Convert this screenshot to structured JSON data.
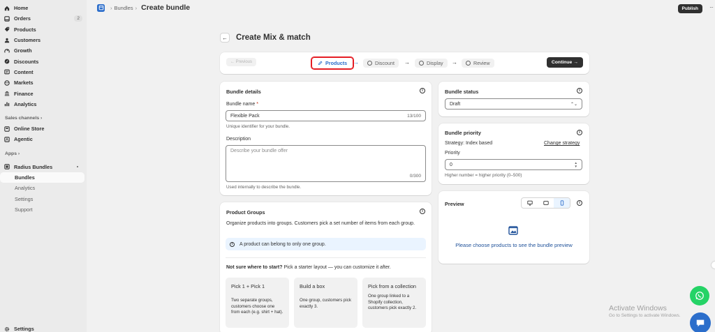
{
  "sidebar": {
    "items": [
      {
        "label": "Home",
        "icon": "home-icon"
      },
      {
        "label": "Orders",
        "icon": "orders-icon",
        "badge": "2"
      },
      {
        "label": "Products",
        "icon": "tag-icon"
      },
      {
        "label": "Customers",
        "icon": "person-icon"
      },
      {
        "label": "Growth",
        "icon": "growth-icon"
      },
      {
        "label": "Discounts",
        "icon": "discount-icon"
      },
      {
        "label": "Content",
        "icon": "content-icon"
      },
      {
        "label": "Markets",
        "icon": "globe-icon"
      },
      {
        "label": "Finance",
        "icon": "bank-icon"
      },
      {
        "label": "Analytics",
        "icon": "bar-chart-icon"
      }
    ],
    "sales_channels_label": "Sales channels ›",
    "channels": [
      {
        "label": "Online Store",
        "icon": "store-icon"
      },
      {
        "label": "Agentic",
        "icon": "agentic-icon"
      }
    ],
    "apps_label": "Apps ›",
    "app_name": "Radius Bundles",
    "app_sub": [
      "Bundles",
      "Analytics",
      "Settings",
      "Support"
    ],
    "settings_label": "Settings"
  },
  "topbar": {
    "crumb_parent": "Bundles",
    "crumb_sep": "›",
    "crumb_current": "Create bundle",
    "publish_label": "Publish",
    "more_label": "···"
  },
  "page": {
    "title": "Create Mix & match",
    "back_label": "←"
  },
  "stepper": {
    "previous_label": "← Previous",
    "steps": [
      "Products",
      "Discount",
      "Display",
      "Review"
    ],
    "arrow": "→",
    "continue_label": "Continue →"
  },
  "bundle_details": {
    "title": "Bundle details",
    "name_label": "Bundle name",
    "required_mark": "*",
    "name_value": "Flexible Pack",
    "name_count": "13/100",
    "name_help": "Unique identifier for your bundle.",
    "desc_label": "Description",
    "desc_placeholder": "Describe your bundle offer",
    "desc_count": "0/300",
    "desc_help": "Used internally to describe the bundle."
  },
  "product_groups": {
    "title": "Product Groups",
    "intro": "Organize products into groups. Customers pick a set number of items from each group.",
    "banner": "A product can belong to only one group.",
    "starter_bold": "Not sure where to start?",
    "starter_rest": " Pick a starter layout — you can customize it after.",
    "starters": [
      {
        "title": "Pick 1 + Pick 1",
        "desc": "Two separate groups, customers choose one from each (e.g. shirt + hat)."
      },
      {
        "title": "Build a box",
        "desc": "One group, customers pick exactly 3."
      },
      {
        "title": "Pick from a collection",
        "desc": "One group linked to a Shopify collection, customers pick exactly 2."
      }
    ]
  },
  "bundle_status": {
    "title": "Bundle status",
    "value": "Draft"
  },
  "bundle_priority": {
    "title": "Bundle priority",
    "strategy": "Strategy: Index based",
    "change_link": "Change strategy",
    "priority_label": "Priority",
    "priority_value": "0",
    "help": "Higher number = higher priority (0–500)"
  },
  "preview": {
    "title": "Preview",
    "message": "Please choose products to see the bundle preview"
  },
  "windows": {
    "line1": "Activate Windows",
    "line2": "Go to Settings to activate Windows."
  },
  "colors": {
    "accent": "#2c6ecb",
    "highlight_border": "#e51c23",
    "dark_button": "#303030",
    "whatsapp": "#25d366"
  }
}
